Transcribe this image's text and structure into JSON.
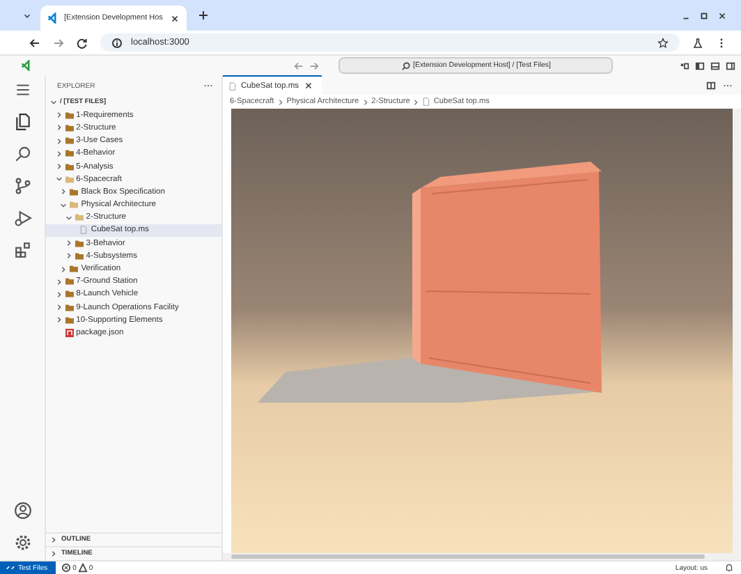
{
  "browser": {
    "tab_title": "[Extension Development Hos",
    "url": "localhost:3000"
  },
  "title_bar": {
    "command_center": "[Extension Development Host] / [Test Files]"
  },
  "explorer": {
    "title": "EXPLORER",
    "tree": [
      {
        "label": "/ [TEST FILES]",
        "kind": "root",
        "expanded": true,
        "selected": false,
        "children": [
          {
            "label": "1-Requirements",
            "kind": "folder",
            "expanded": false,
            "selected": false
          },
          {
            "label": "2-Structure",
            "kind": "folder",
            "expanded": false,
            "selected": false
          },
          {
            "label": "3-Use Cases",
            "kind": "folder",
            "expanded": false,
            "selected": false
          },
          {
            "label": "4-Behavior",
            "kind": "folder",
            "expanded": false,
            "selected": false
          },
          {
            "label": "5-Analysis",
            "kind": "folder",
            "expanded": false,
            "selected": false
          },
          {
            "label": "6-Spacecraft",
            "kind": "folder",
            "expanded": true,
            "selected": false,
            "children": [
              {
                "label": "Black Box Specification",
                "kind": "folder",
                "expanded": false,
                "selected": false
              },
              {
                "label": "Physical Architecture",
                "kind": "folder",
                "expanded": true,
                "selected": false,
                "children": [
                  {
                    "label": "2-Structure",
                    "kind": "folder",
                    "expanded": true,
                    "selected": false,
                    "children": [
                      {
                        "label": "CubeSat top.ms",
                        "kind": "file",
                        "selected": true
                      }
                    ]
                  },
                  {
                    "label": "3-Behavior",
                    "kind": "folder",
                    "expanded": false,
                    "selected": false
                  },
                  {
                    "label": "4-Subsystems",
                    "kind": "folder",
                    "expanded": false,
                    "selected": false
                  }
                ]
              },
              {
                "label": "Verification",
                "kind": "folder",
                "expanded": false,
                "selected": false
              }
            ]
          },
          {
            "label": "7-Ground Station",
            "kind": "folder",
            "expanded": false,
            "selected": false
          },
          {
            "label": "8-Launch Vehicle",
            "kind": "folder",
            "expanded": false,
            "selected": false
          },
          {
            "label": "9-Launch Operations Facility",
            "kind": "folder",
            "expanded": false,
            "selected": false
          },
          {
            "label": "10-Supporting Elements",
            "kind": "folder",
            "expanded": false,
            "selected": false
          },
          {
            "label": "package.json",
            "kind": "npm",
            "selected": false
          }
        ]
      }
    ]
  },
  "sections": [
    {
      "label": "OUTLINE",
      "expanded": false
    },
    {
      "label": "TIMELINE",
      "expanded": false
    }
  ],
  "editor": {
    "tabs": [
      {
        "label": "CubeSat top.ms",
        "selected": true
      }
    ],
    "breadcrumbs": [
      "6-Spacecraft",
      "Physical Architecture",
      "2-Structure",
      "CubeSat top.ms"
    ]
  },
  "status_bar": {
    "remote": "Test Files",
    "errors": "0",
    "warnings": "0",
    "layout": "Layout: us"
  }
}
